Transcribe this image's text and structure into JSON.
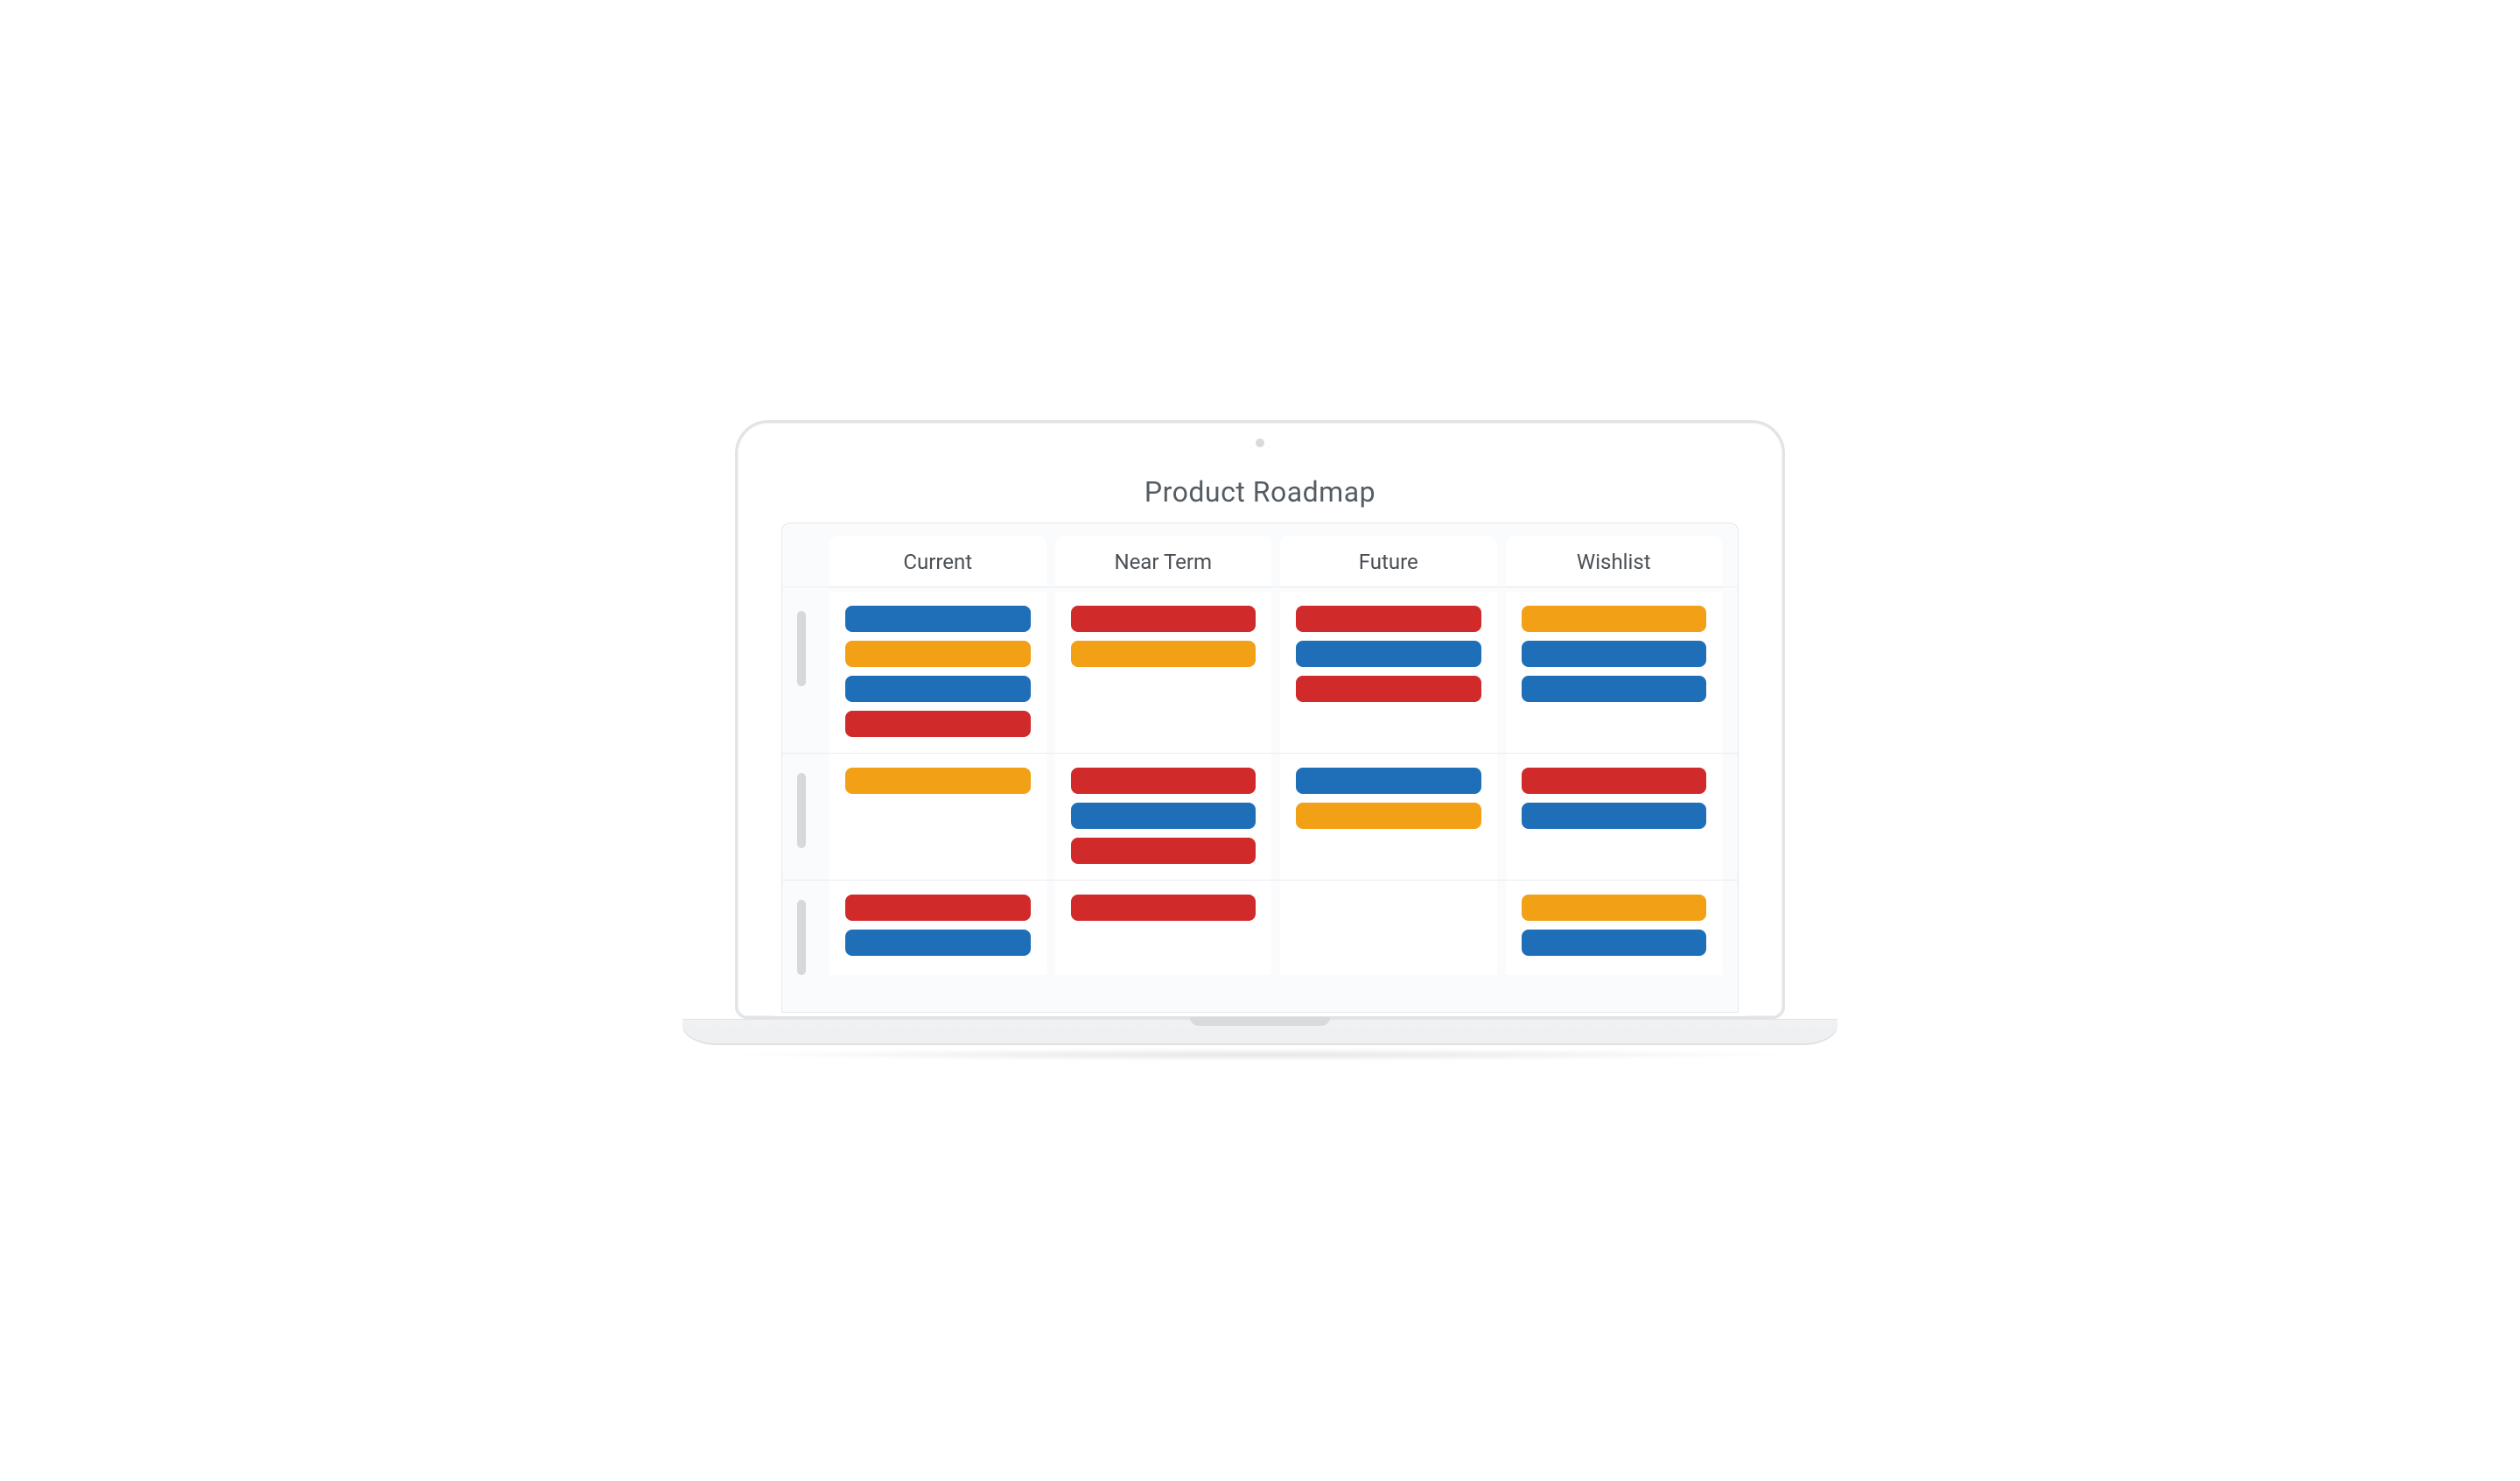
{
  "title": "Product Roadmap",
  "colors": {
    "red": "#d12a2a",
    "blue": "#1e6fb8",
    "orange": "#f2a016"
  },
  "columns": [
    {
      "id": "current",
      "label": "Current"
    },
    {
      "id": "near-term",
      "label": "Near Term"
    },
    {
      "id": "future",
      "label": "Future"
    },
    {
      "id": "wishlist",
      "label": "Wishlist"
    }
  ],
  "rows": [
    {
      "cells": [
        [
          "blue",
          "orange",
          "blue",
          "red"
        ],
        [
          "red",
          "orange"
        ],
        [
          "red",
          "blue",
          "red"
        ],
        [
          "orange",
          "blue",
          "blue"
        ]
      ]
    },
    {
      "cells": [
        [
          "orange"
        ],
        [
          "red",
          "blue",
          "red"
        ],
        [
          "blue",
          "orange"
        ],
        [
          "red",
          "blue"
        ]
      ]
    },
    {
      "cells": [
        [
          "red",
          "blue"
        ],
        [
          "red"
        ],
        [],
        [
          "orange",
          "blue"
        ]
      ]
    }
  ]
}
